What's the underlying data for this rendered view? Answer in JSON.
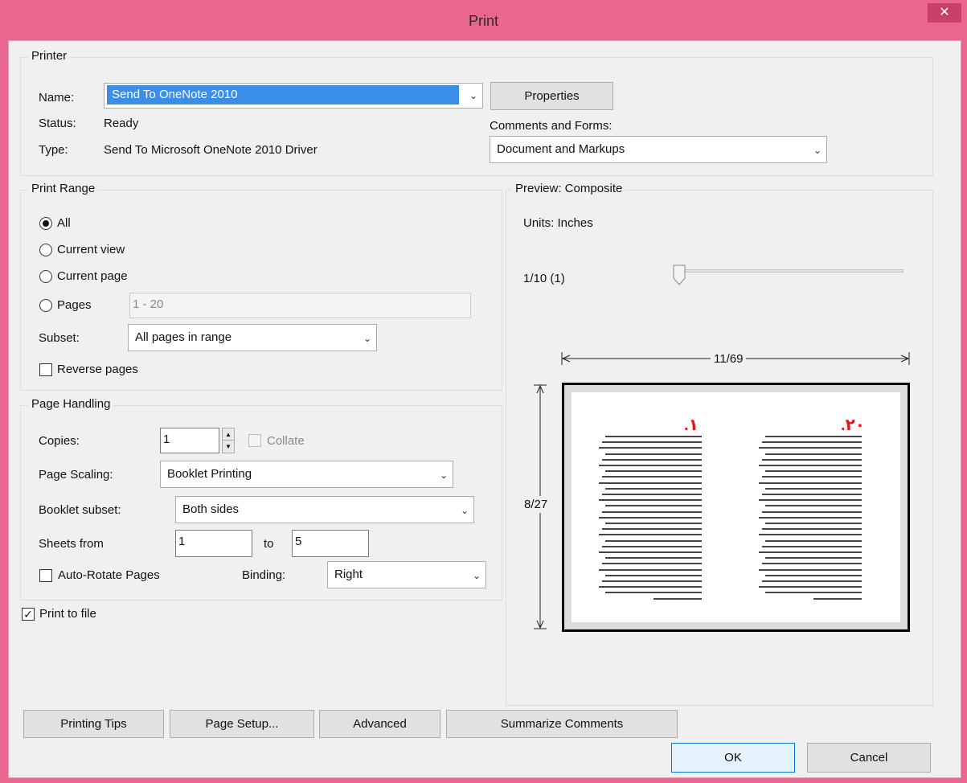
{
  "window": {
    "title": "Print",
    "close_glyph": "✕"
  },
  "printer": {
    "legend": "Printer",
    "name_label": "Name:",
    "name_value": "Send To OneNote 2010",
    "status_label": "Status:",
    "status_value": "Ready",
    "type_label": "Type:",
    "type_value": "Send To Microsoft OneNote 2010 Driver",
    "properties_button": "Properties",
    "comments_label": "Comments and Forms:",
    "comments_value": "Document and Markups"
  },
  "print_range": {
    "legend": "Print Range",
    "all": "All",
    "current_view": "Current view",
    "current_page": "Current page",
    "pages": "Pages",
    "pages_value": "1 - 20",
    "subset_label": "Subset:",
    "subset_value": "All pages in range",
    "reverse_pages": "Reverse pages"
  },
  "page_handling": {
    "legend": "Page Handling",
    "copies_label": "Copies:",
    "copies_value": "1",
    "collate": "Collate",
    "scaling_label": "Page Scaling:",
    "scaling_value": "Booklet Printing",
    "booklet_label": "Booklet subset:",
    "booklet_value": "Both sides",
    "sheets_label": "Sheets from",
    "sheets_from": "1",
    "to_label": "to",
    "sheets_to": "5",
    "auto_rotate": "Auto-Rotate Pages",
    "binding_label": "Binding:",
    "binding_value": "Right"
  },
  "print_to_file": "Print to file",
  "preview": {
    "legend": "Preview: Composite",
    "units": "Units: Inches",
    "page_counter": "1/10 (1)",
    "width_label": "11/69",
    "height_label": "8/27",
    "left_page_number": ".١",
    "right_page_number": ".٢٠"
  },
  "buttons": {
    "printing_tips": "Printing Tips",
    "page_setup": "Page Setup...",
    "advanced": "Advanced",
    "summarize": "Summarize Comments",
    "ok": "OK",
    "cancel": "Cancel"
  },
  "icons": {
    "dropdown": "chevron-down-icon",
    "close": "close-icon"
  }
}
